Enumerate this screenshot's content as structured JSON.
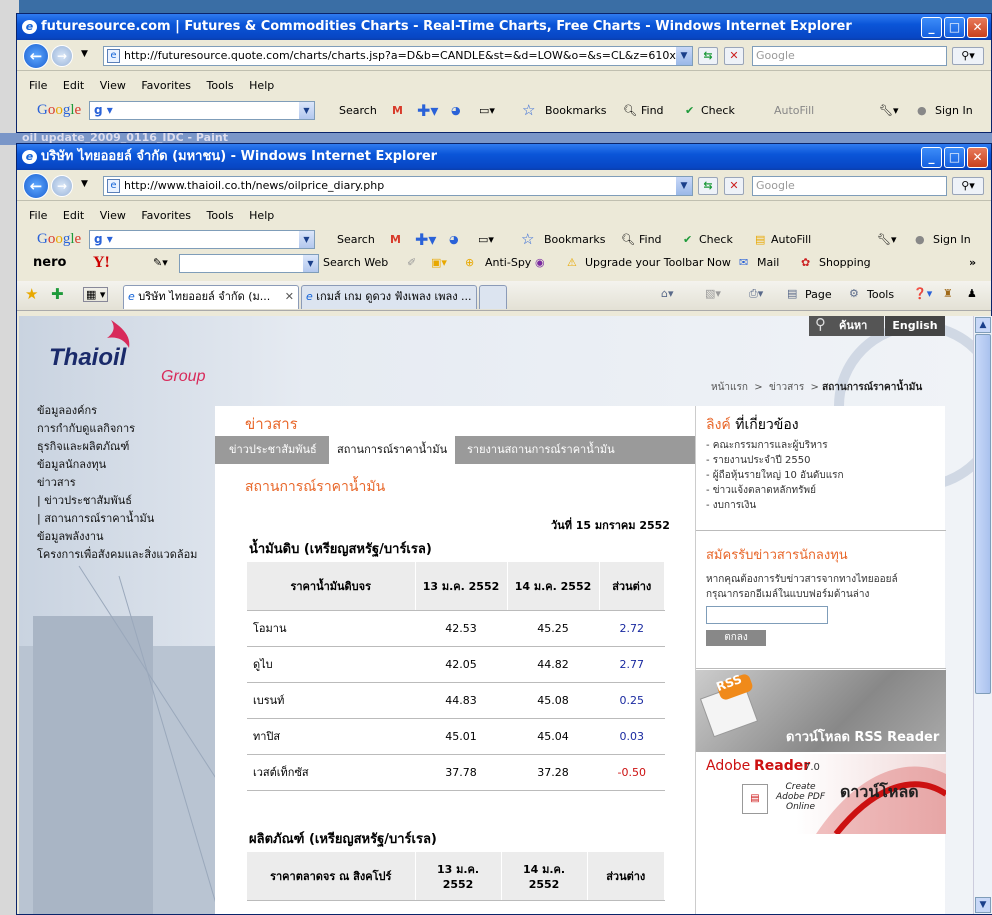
{
  "back_window": {
    "title": "futuresource.com | Futures & Commodities Charts - Real-Time Charts, Free Charts - Windows Internet Explorer",
    "url": "http://futuresource.quote.com/charts/charts.jsp?a=D&b=CANDLE&st=&d=LOW&o=&s=CL&z=610x300",
    "search_placeholder": "Google",
    "menu": [
      "File",
      "Edit",
      "View",
      "Favorites",
      "Tools",
      "Help"
    ],
    "toolbar": {
      "search": "Search",
      "bookmarks": "Bookmarks",
      "find": "Find",
      "check": "Check",
      "autofill": "AutoFill",
      "signin": "Sign In"
    }
  },
  "paint_title": "oil update_2009_0116_IDC - Paint",
  "front_window": {
    "title": "บริษัท ไทยออยล์ จำกัด (มหาชน) - Windows Internet Explorer",
    "url": "http://www.thaioil.co.th/news/oilprice_diary.php",
    "search_placeholder": "Google",
    "menu": [
      "File",
      "Edit",
      "View",
      "Favorites",
      "Tools",
      "Help"
    ],
    "google_toolbar": {
      "search": "Search",
      "bookmarks": "Bookmarks",
      "find": "Find",
      "check": "Check",
      "autofill": "AutoFill",
      "signin": "Sign In"
    },
    "yahoo_toolbar": {
      "nero": "nero",
      "yahoo": "Y!",
      "search_web": "Search Web",
      "anti_spy": "Anti-Spy",
      "upgrade": "Upgrade your Toolbar Now",
      "mail": "Mail",
      "shopping": "Shopping"
    },
    "tabs": [
      {
        "label": "บริษัท ไทยออยล์ จำกัด (ม..."
      },
      {
        "label": "เกมส์ เกม ดูดวง ฟังเพลง เพลง ..."
      }
    ],
    "command_bar": {
      "page": "Page",
      "tools": "Tools"
    }
  },
  "site": {
    "search_label": "ค้นหา",
    "english_label": "English",
    "logo_main": "Thaioil",
    "logo_sub": "Group",
    "breadcrumb": {
      "home": "หน้าแรก",
      "news": "ข่าวสาร",
      "current": "สถานการณ์ราคาน้ำมัน"
    },
    "left_nav": [
      "ข้อมูลองค์กร",
      "การกำกับดูแลกิจการ",
      "ธุรกิจและผลิตภัณฑ์",
      "ข้อมูลนักลงทุน",
      "ข่าวสาร",
      "| ข่าวประชาสัมพันธ์",
      "| สถานการณ์ราคาน้ำมัน",
      "ข้อมูลพลังงาน",
      "โครงการเพื่อสังคมและสิ่งแวดล้อม"
    ],
    "section_title": "ข่าวสาร",
    "subtabs": [
      "ข่าวประชาสัมพันธ์",
      "สถานการณ์ราคาน้ำมัน",
      "รายงานสถานการณ์ราคาน้ำมัน"
    ],
    "page_title": "สถานการณ์ราคาน้ำมัน",
    "date": "วันที่ 15 มกราคม 2552",
    "crude": {
      "title": "น้ำมันดิบ (เหรียญสหรัฐ/บาร์เรล)",
      "headers": [
        "ราคาน้ำมันดิบจร",
        "13 ม.ค. 2552",
        "14 ม.ค. 2552",
        "ส่วนต่าง"
      ],
      "rows": [
        {
          "name": "โอมาน",
          "d13": "42.53",
          "d14": "45.25",
          "diff": "2.72"
        },
        {
          "name": "ดูไบ",
          "d13": "42.05",
          "d14": "44.82",
          "diff": "2.77"
        },
        {
          "name": "เบรนท์",
          "d13": "44.83",
          "d14": "45.08",
          "diff": "0.25"
        },
        {
          "name": "ทาปิส",
          "d13": "45.01",
          "d14": "45.04",
          "diff": "0.03"
        },
        {
          "name": "เวสต์เท็กซัส",
          "d13": "37.78",
          "d14": "37.28",
          "diff": "-0.50"
        }
      ]
    },
    "products": {
      "title": "ผลิตภัณฑ์ (เหรียญสหรัฐ/บาร์เรล)",
      "headers": [
        "ราคาตลาดจร ณ สิงคโปร์",
        "13 ม.ค. 2552",
        "14 ม.ค. 2552",
        "ส่วนต่าง"
      ]
    },
    "links": {
      "title_a": "ลิงค์",
      "title_b": " ที่เกี่ยวข้อง",
      "items": [
        "- คณะกรรมการและผู้บริหาร",
        "- รายงานประจำปี 2550",
        "- ผู้ถือหุ้นรายใหญ่ 10 อันดับแรก",
        "- ข่าวแจ้งตลาดหลักทรัพย์",
        "- งบการเงิน"
      ]
    },
    "subscribe": {
      "title": "สมัครรับข่าวสารนักลงทุน",
      "desc1": "หากคุณต้องการรับข่าวสารจากทางไทยออยล์",
      "desc2": "กรุณากรอกอีเมล์ในแบบฟอร์มด้านล่าง",
      "button": "ตกลง"
    },
    "rss": {
      "label": "ดาวน์โหลด RSS Reader",
      "badge": "RSS"
    },
    "adobe": {
      "brand": "Adobe",
      "product": "Reader",
      "version": "7.0",
      "create": "Create",
      "pdf": "Adobe PDF",
      "online": "Online",
      "download": "ดาวน์โหลด"
    }
  }
}
